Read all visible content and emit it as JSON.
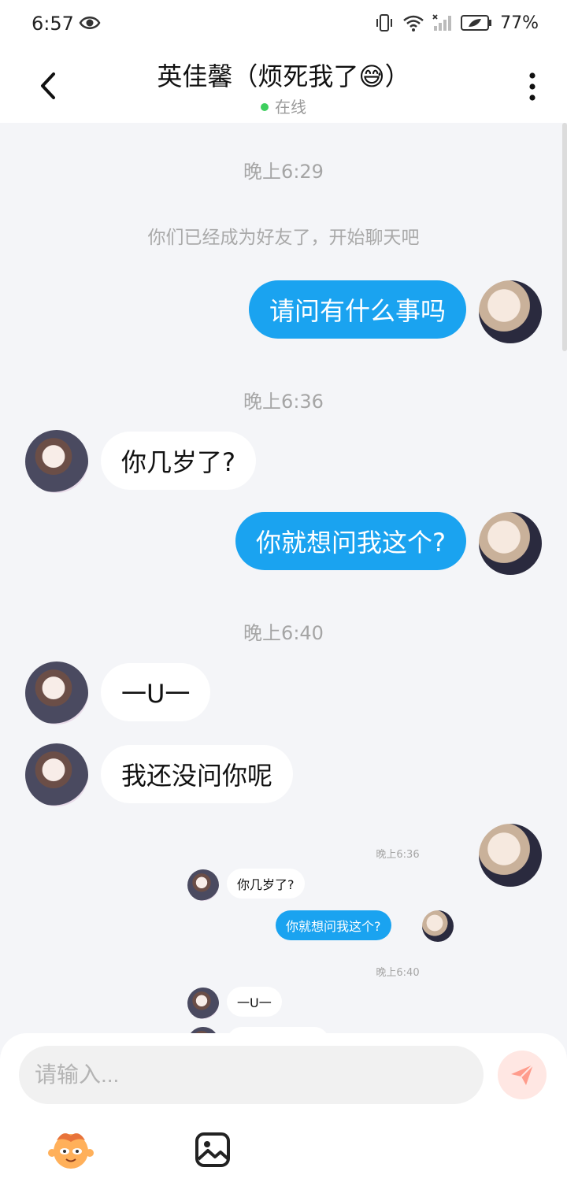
{
  "status_bar": {
    "time": "6:57",
    "battery": "77%"
  },
  "header": {
    "title": "英佳馨（烦死我了😅）",
    "presence": "在线"
  },
  "messages": [
    {
      "type": "timestamp",
      "text": "晚上6:29"
    },
    {
      "type": "system",
      "text": "你们已经成为好友了，开始聊天吧"
    },
    {
      "type": "outgoing",
      "text": "请问有什么事吗"
    },
    {
      "type": "timestamp",
      "text": "晚上6:36"
    },
    {
      "type": "incoming",
      "text": "你几岁了?"
    },
    {
      "type": "outgoing",
      "text": "你就想问我这个?"
    },
    {
      "type": "timestamp",
      "text": "晚上6:40"
    },
    {
      "type": "incoming",
      "text": "一U一"
    },
    {
      "type": "incoming",
      "text": "我还没问你呢"
    }
  ],
  "quoted_screenshot": {
    "timestamp_1": "晚上6:36",
    "incoming_1": "你几岁了?",
    "outgoing_1": "你就想问我这个?",
    "timestamp_2": "晚上6:40",
    "incoming_2": "一U一"
  },
  "input": {
    "placeholder": "请输入..."
  },
  "colors": {
    "accent": "#1aa3f0",
    "background": "#f4f5f8",
    "send_button_bg": "#ffe7e3",
    "online_dot": "#3ecf5e"
  },
  "icons": [
    "back-arrow-icon",
    "more-vertical-icon",
    "send-icon",
    "emoji-sticker-icon",
    "image-icon"
  ]
}
